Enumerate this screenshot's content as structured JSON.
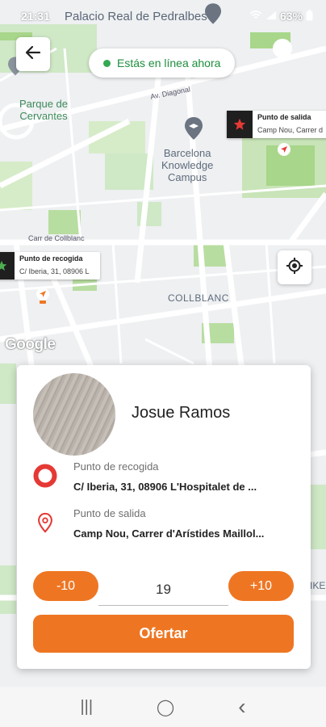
{
  "status_bar": {
    "time": "21:31",
    "battery": "63%",
    "behind_text": "Palacio Real de Pedralbes"
  },
  "map": {
    "labels": {
      "parque": "Parque de\nCervantes",
      "knowledge": "Barcelona\nKnowledge\nCampus",
      "collblanc": "COLLBLANC",
      "carrer_collblanc": "Carr de Collblanc",
      "av_diagonal": "Av. Diagonal",
      "right_edge": "IKE"
    },
    "online_status": "Estás en línea ahora",
    "google": "Google",
    "dropoff_marker": {
      "title": "Punto de salida",
      "subtitle": "Camp Nou, Carrer d"
    },
    "pickup_marker": {
      "title": "Punto de recogida",
      "subtitle": "C/ Iberia, 31, 08906 L"
    }
  },
  "trip": {
    "passenger_name": "Josue Ramos",
    "pickup_label": "Punto de recogida",
    "pickup_address": "C/ Iberia, 31, 08906 L'Hospitalet de ...",
    "dropoff_label": "Punto de salida",
    "dropoff_address": "Camp Nou, Carrer d'Arístides Maillol...",
    "decrease_label": "-10",
    "price_value": "19",
    "increase_label": "+10",
    "offer_label": "Ofertar"
  },
  "colors": {
    "accent": "#ee7623",
    "online_green": "#34a853",
    "pickup_red": "#e53935"
  },
  "navbar": {
    "recents_glyph": "|||",
    "home_glyph": "◯",
    "back_glyph": "‹"
  }
}
